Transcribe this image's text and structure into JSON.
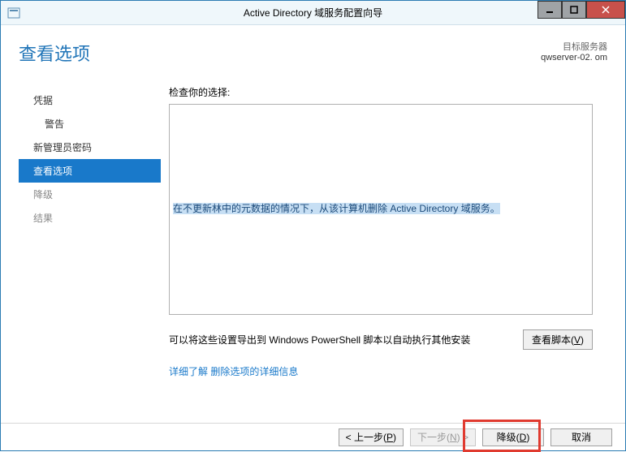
{
  "titlebar": {
    "title": "Active Directory 域服务配置向导"
  },
  "header": {
    "page_title": "查看选项",
    "target_label": "目标服务器",
    "target_server": "qwserver-02.                     om"
  },
  "sidebar": {
    "items": [
      {
        "label": "凭据",
        "state": "done"
      },
      {
        "label": "警告",
        "state": "done sub"
      },
      {
        "label": "新管理员密码",
        "state": "done"
      },
      {
        "label": "查看选项",
        "state": "active"
      },
      {
        "label": "降级",
        "state": ""
      },
      {
        "label": "结果",
        "state": ""
      }
    ]
  },
  "main": {
    "check_label": "检查你的选择:",
    "review_text": "在不更新林中的元数据的情况下，从该计算机删除 Active Directory 域服务。",
    "export_label": "可以将这些设置导出到 Windows PowerShell 脚本以自动执行其他安装",
    "view_script_btn": "查看脚本",
    "view_script_key": "V",
    "more_link": "详细了解 删除选项的详细信息"
  },
  "footer": {
    "prev": "< 上一步",
    "prev_key": "P",
    "next": "下一步",
    "next_key": "N",
    "next_suffix": " >",
    "demote": "降级",
    "demote_key": "D",
    "cancel": "取消"
  }
}
